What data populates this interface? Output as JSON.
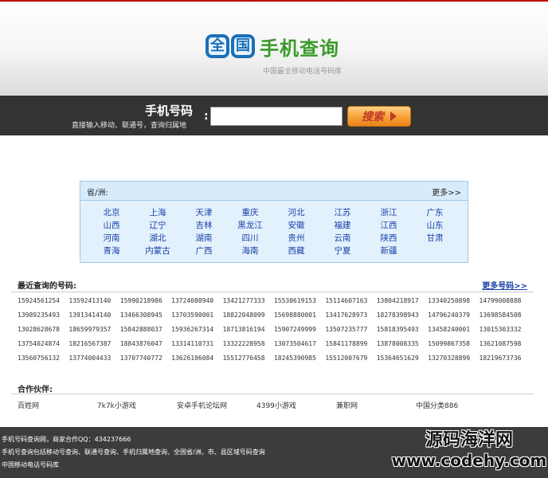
{
  "header": {
    "logo_mark": [
      "全",
      "国"
    ],
    "logo_text": "手机查询",
    "logo_sub": "中国最全移动电话号码库"
  },
  "search": {
    "label": "手机号码",
    "hint": "直接输入移动、联通号，查询归属地",
    "colon": ":",
    "input_value": "",
    "button_label": "搜索"
  },
  "provinces": {
    "title": "省/洲:",
    "more": "更多>>",
    "items": [
      "北京",
      "上海",
      "天津",
      "重庆",
      "河北",
      "江苏",
      "浙江",
      "广东",
      "山西",
      "辽宁",
      "吉林",
      "黑龙江",
      "安徽",
      "福建",
      "江西",
      "山东",
      "河南",
      "湖北",
      "湖南",
      "四川",
      "贵州",
      "云南",
      "陕西",
      "甘肃",
      "青海",
      "内蒙古",
      "广西",
      "海南",
      "西藏",
      "宁夏",
      "新疆"
    ]
  },
  "recent": {
    "title": "最近查询的号码:",
    "more": "更多号码>>",
    "numbers": [
      "15924561254",
      "13592413140",
      "15990218986",
      "13724088940",
      "13421277333",
      "15530619153",
      "15114607163",
      "13804218917",
      "13340250898",
      "14799008888",
      "13989235493",
      "13913414140",
      "13466308945",
      "13703590001",
      "18822048099",
      "15698880001",
      "13417628973",
      "18278398943",
      "14796240379",
      "13698584508",
      "13028628678",
      "18659979357",
      "15842888037",
      "15936267314",
      "18713816194",
      "15907249999",
      "13507235777",
      "15818395493",
      "13458240001",
      "13015303332",
      "13754024874",
      "18216567387",
      "18843876047",
      "13314110731",
      "13322228958",
      "13073504617",
      "15841178899",
      "13878008335",
      "15099867358",
      "13621087598",
      "13560756132",
      "13774004433",
      "13707740772",
      "13626106084",
      "15512776458",
      "18245390985",
      "15512007679",
      "15364651629",
      "13270328899",
      "18219673736"
    ]
  },
  "partners": {
    "title": "合作伙伴:",
    "items": [
      "百姓网",
      "7k7k小游戏",
      "安卓手机论坛网",
      "4399小游戏",
      "兼职网",
      "中国分类886"
    ]
  },
  "footer": {
    "lines": [
      "手机号码查询网，商家合作QQ：434237666",
      "手机号查询包括移动号查询、联通号查询、手机归属地查询、全国省/洲、市、县区域号码查询",
      "中国移动电话号码库"
    ]
  },
  "watermark": {
    "cn": "源码海洋网",
    "en": "www.codehy.com"
  },
  "colors": {
    "accent_red": "#c00000",
    "logo_green": "#3a9a2a",
    "logo_blue": "#1a6fb8",
    "link_blue": "#1a3fa8",
    "search_bar": "#333333",
    "province_bg": "#e2f1fc",
    "footer_bg": "#3c3c3c"
  }
}
